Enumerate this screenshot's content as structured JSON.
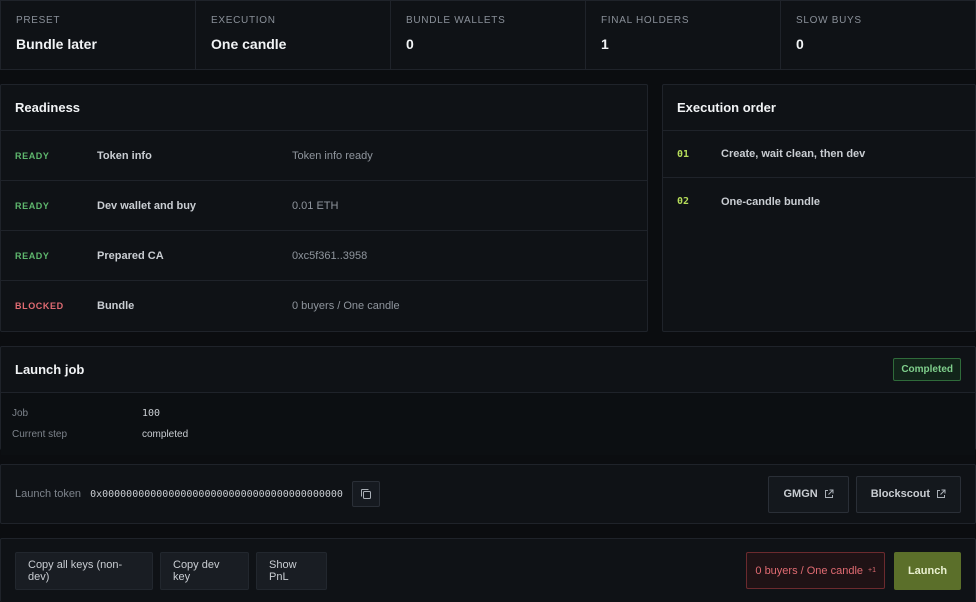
{
  "stats": [
    {
      "label": "PRESET",
      "value": "Bundle later"
    },
    {
      "label": "EXECUTION",
      "value": "One candle"
    },
    {
      "label": "BUNDLE WALLETS",
      "value": "0"
    },
    {
      "label": "FINAL HOLDERS",
      "value": "1"
    },
    {
      "label": "SLOW BUYS",
      "value": "0"
    }
  ],
  "readiness": {
    "title": "Readiness",
    "rows": [
      {
        "status": "READY",
        "name": "Token info",
        "detail": "Token info ready"
      },
      {
        "status": "READY",
        "name": "Dev wallet and buy",
        "detail": "0.01 ETH"
      },
      {
        "status": "READY",
        "name": "Prepared CA",
        "detail": "0xc5f361..3958"
      },
      {
        "status": "BLOCKED",
        "name": "Bundle",
        "detail": "0 buyers / One candle"
      }
    ]
  },
  "execution": {
    "title": "Execution order",
    "steps": [
      {
        "num": "01",
        "label": "Create, wait clean, then dev"
      },
      {
        "num": "02",
        "label": "One-candle bundle"
      }
    ]
  },
  "job": {
    "title": "Launch job",
    "badge": "Completed",
    "fields": [
      {
        "key": "Job",
        "value": "100"
      },
      {
        "key": "Current step",
        "value": "completed"
      }
    ]
  },
  "token": {
    "label": "Launch token",
    "address": "0x0000000000000000000000000000000000000000",
    "links": [
      "GMGN",
      "Blockscout"
    ]
  },
  "actions": {
    "copy_all": "Copy all keys (non-dev)",
    "copy_dev": "Copy dev key",
    "show_pnl": "Show PnL",
    "warning": "0 buyers / One candle",
    "warning_count": "+1",
    "launch": "Launch"
  },
  "colors": {
    "ready": "#5fb86e",
    "blocked": "#e06b72",
    "accent": "#b6dd5a",
    "launch": "#5b6f2a"
  }
}
